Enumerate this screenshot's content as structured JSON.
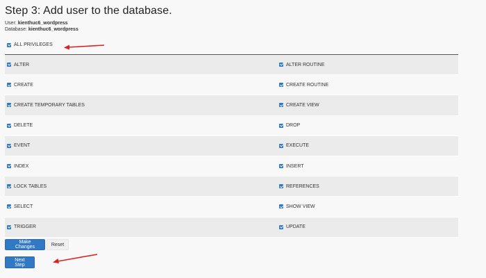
{
  "page": {
    "title": "Step 3: Add user to the database.",
    "user_label": "User:",
    "user_value": "kienthuc6_wordpress",
    "database_label": "Database:",
    "database_value": "kienthuc6_wordpress"
  },
  "all_privileges": {
    "label": "ALL PRIVILEGES",
    "checked": true
  },
  "privileges": [
    {
      "left": "ALTER",
      "right": "ALTER ROUTINE"
    },
    {
      "left": "CREATE",
      "right": "CREATE ROUTINE"
    },
    {
      "left": "CREATE TEMPORARY TABLES",
      "right": "CREATE VIEW"
    },
    {
      "left": "DELETE",
      "right": "DROP"
    },
    {
      "left": "EVENT",
      "right": "EXECUTE"
    },
    {
      "left": "INDEX",
      "right": "INSERT"
    },
    {
      "left": "LOCK TABLES",
      "right": "REFERENCES"
    },
    {
      "left": "SELECT",
      "right": "SHOW VIEW"
    },
    {
      "left": "TRIGGER",
      "right": "UPDATE"
    }
  ],
  "buttons": {
    "make_changes": "Make Changes",
    "reset": "Reset",
    "next_step": "Next Step"
  },
  "colors": {
    "accent": "#3279c5",
    "annotation_arrow": "#e02020"
  }
}
